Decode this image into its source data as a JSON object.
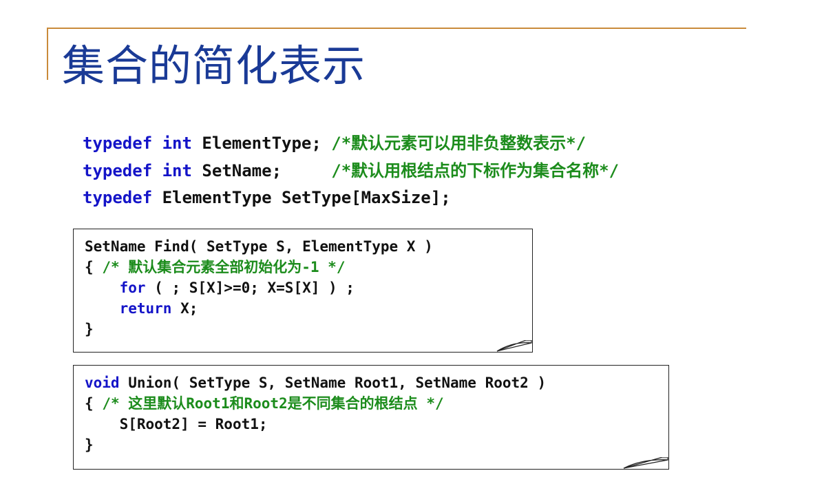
{
  "title": "集合的简化表示",
  "typedefs": [
    {
      "kw": "typedef",
      "type": "int",
      "name": "ElementType",
      "punct": ";",
      "comment": "/*默认元素可以用非负整数表示*/"
    },
    {
      "kw": "typedef",
      "type": "int",
      "name": "SetName",
      "punct": ";",
      "comment": "/*默认用根结点的下标作为集合名称*/"
    },
    {
      "kw": "typedef",
      "decl": "ElementType SetType[MaxSize];"
    }
  ],
  "find_box": {
    "signature": "SetName Find( SetType S, ElementType X )",
    "open_brace": "{",
    "comment": "/* 默认集合元素全部初始化为-1 */",
    "for_kw": "for",
    "for_body": " ( ; S[X]>=0; X=S[X] ) ;",
    "return_kw": "return",
    "return_body": " X;",
    "close_brace": "}"
  },
  "union_box": {
    "void_kw": "void",
    "signature": " Union( SetType S, SetName Root1, SetName Root2 )",
    "open_brace": "{",
    "comment": "/* 这里默认Root1和Root2是不同集合的根结点 */",
    "stmt": "S[Root2] = Root1;",
    "close_brace": "}"
  }
}
